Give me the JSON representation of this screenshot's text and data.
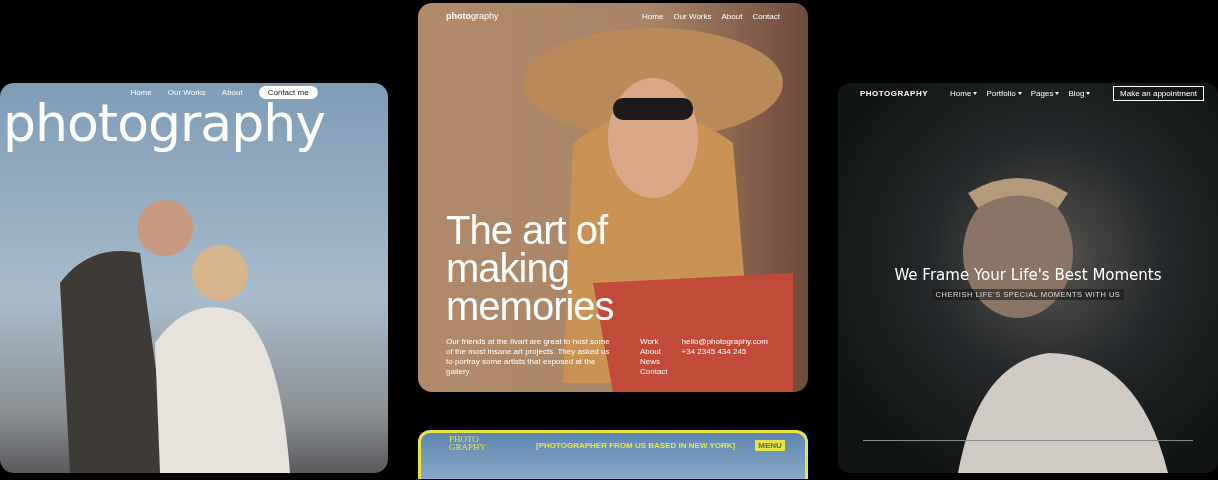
{
  "previews": [
    {
      "kind": "couple",
      "nav": [
        {
          "label": "Home"
        },
        {
          "label": "Our Works"
        },
        {
          "label": "About"
        }
      ],
      "cta": "Contact me",
      "logo": "photography"
    },
    {
      "kind": "portrait",
      "logo_bold": "photo",
      "logo_rest": "graphy",
      "nav": [
        {
          "label": "Home"
        },
        {
          "label": "Our Works"
        },
        {
          "label": "About"
        },
        {
          "label": "Contact"
        }
      ],
      "headline": [
        "The art of",
        "making",
        "memories"
      ],
      "paragraph": "Our friends at the Ilvart are great to host some of the most insane art projects. They asked us to portray some artists that exposed at the gallery.",
      "links": [
        "Work",
        "About",
        "News",
        "Contact"
      ],
      "contact": [
        "hello@photography.com",
        "+34 2345 434 245"
      ]
    },
    {
      "kind": "yellow",
      "logo": [
        "PHOTO",
        "GRAPHY"
      ],
      "tagline": "[PHOTOGRAPHER FROM US BASED IN NEW YORK]",
      "badge": "MENU"
    },
    {
      "kind": "dark",
      "logo": "PHOTOGRAPHY",
      "nav": [
        {
          "label": "Home"
        },
        {
          "label": "Portfolio"
        },
        {
          "label": "Pages"
        },
        {
          "label": "Blog"
        }
      ],
      "cta": "Make an appointment",
      "headline": "We Frame Your Life's Best Moments",
      "subtitle": "CHERISH LIFE'S SPECIAL MOMENTS WITH US"
    }
  ]
}
